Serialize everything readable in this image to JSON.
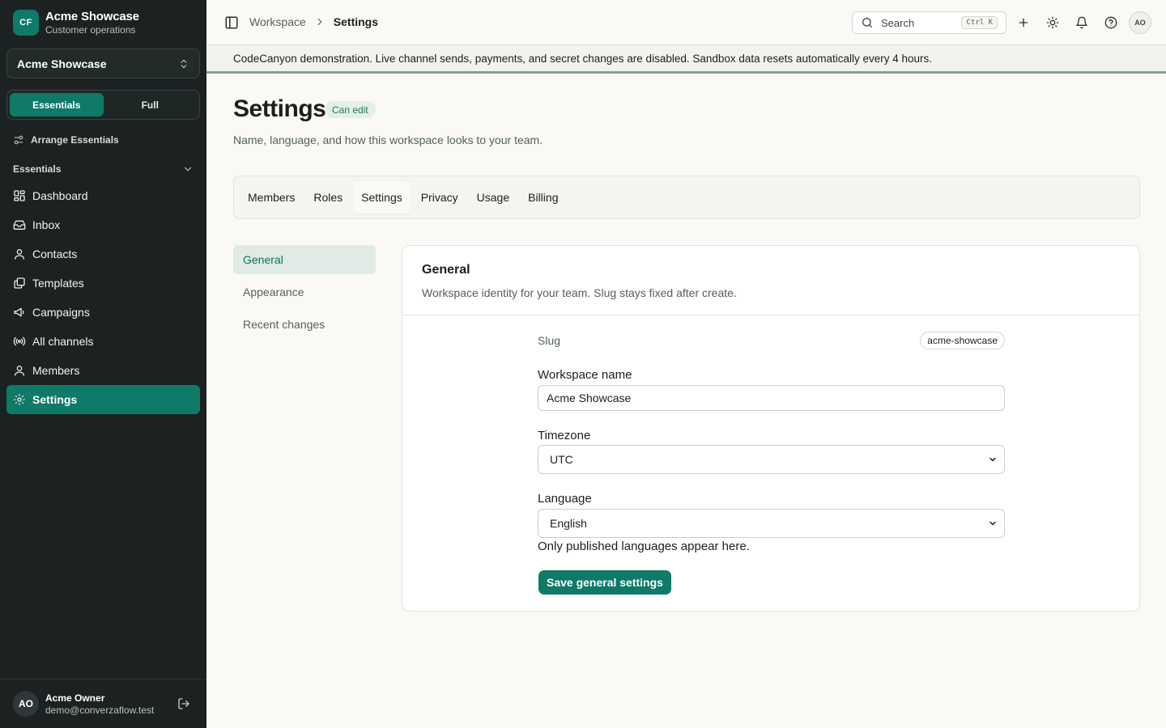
{
  "sidebar": {
    "brand_initials": "CF",
    "brand_name": "Acme Showcase",
    "brand_sub": "Customer operations",
    "workspace_switcher": "Acme Showcase",
    "mode_toggle": {
      "essentials": "Essentials",
      "full": "Full",
      "active": "Essentials"
    },
    "arrange_label": "Arrange Essentials",
    "section_label": "Essentials",
    "items": [
      {
        "label": "Dashboard",
        "icon": "dashboard-icon"
      },
      {
        "label": "Inbox",
        "icon": "inbox-icon"
      },
      {
        "label": "Contacts",
        "icon": "contacts-icon"
      },
      {
        "label": "Templates",
        "icon": "templates-icon"
      },
      {
        "label": "Campaigns",
        "icon": "megaphone-icon"
      },
      {
        "label": "All channels",
        "icon": "broadcast-icon"
      },
      {
        "label": "Members",
        "icon": "members-icon"
      },
      {
        "label": "Settings",
        "icon": "gear-icon",
        "active": true
      }
    ],
    "user": {
      "initials": "AO",
      "name": "Acme Owner",
      "email": "demo@converzaflow.test"
    }
  },
  "topbar": {
    "breadcrumb": {
      "parent": "Workspace",
      "current": "Settings"
    },
    "search_placeholder": "Search",
    "search_shortcut": "Ctrl K",
    "avatar_initials": "AO"
  },
  "banner": "CodeCanyon demonstration. Live channel sends, payments, and secret changes are disabled. Sandbox data resets automatically every 4 hours.",
  "page": {
    "title": "Settings",
    "permission_badge": "Can edit",
    "subtitle": "Name, language, and how this workspace looks to your team."
  },
  "tabs": [
    {
      "label": "Members"
    },
    {
      "label": "Roles"
    },
    {
      "label": "Settings",
      "active": true
    },
    {
      "label": "Privacy"
    },
    {
      "label": "Usage"
    },
    {
      "label": "Billing"
    }
  ],
  "subnav": [
    {
      "label": "General",
      "active": true
    },
    {
      "label": "Appearance"
    },
    {
      "label": "Recent changes"
    }
  ],
  "general": {
    "title": "General",
    "description": "Workspace identity for your team. Slug stays fixed after create.",
    "slug_label": "Slug",
    "slug_value": "acme-showcase",
    "workspace_name_label": "Workspace name",
    "workspace_name_value": "Acme Showcase",
    "timezone_label": "Timezone",
    "timezone_value": "UTC",
    "language_label": "Language",
    "language_value": "English",
    "language_hint": "Only published languages appear here.",
    "save_label": "Save general settings"
  },
  "colors": {
    "sidebar_bg": "#1c2222",
    "accent": "#0f7a68",
    "page_bg": "#faf9f6",
    "badge_bg": "#e4efe9"
  }
}
